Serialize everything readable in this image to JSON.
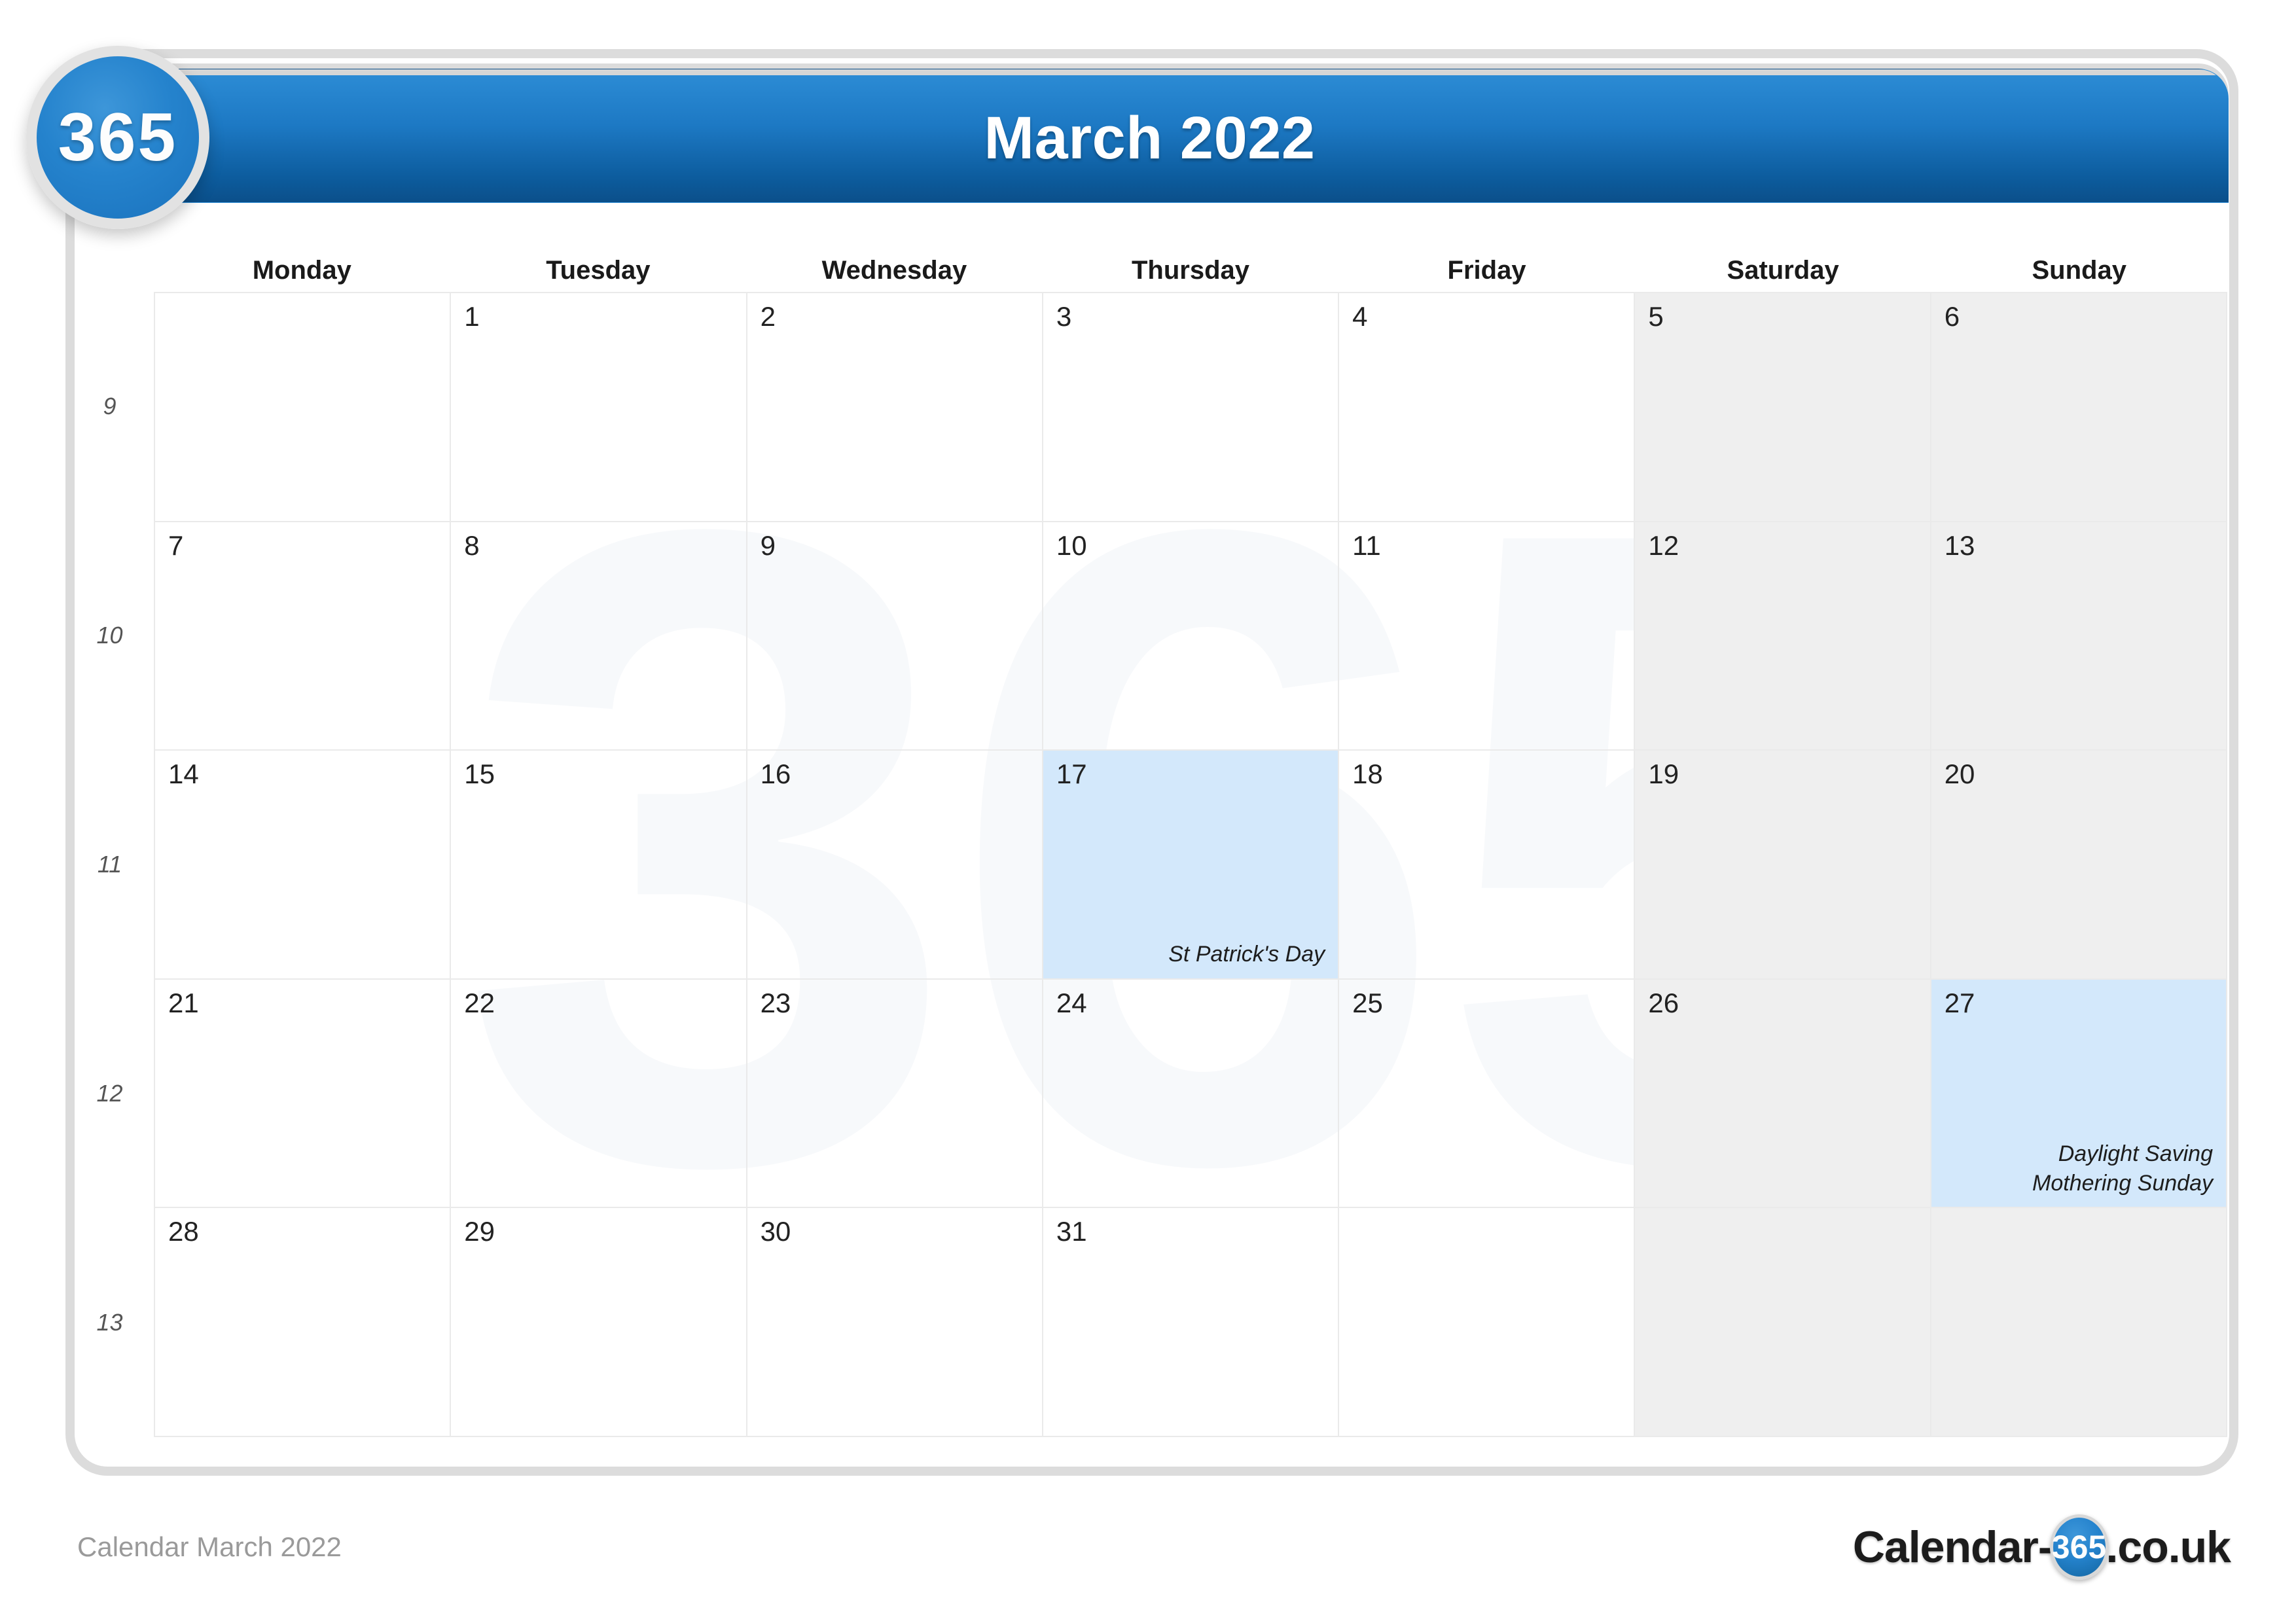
{
  "brand": {
    "badge_label": "365",
    "accent_color": "#1d79c4",
    "weekend_bg": "#efefef",
    "highlight_bg": "#d3e8fb",
    "grid_line_color": "#eaeaea"
  },
  "header": {
    "title": "March 2022"
  },
  "weekdays": [
    "Monday",
    "Tuesday",
    "Wednesday",
    "Thursday",
    "Friday",
    "Saturday",
    "Sunday"
  ],
  "week_numbers": [
    "9",
    "10",
    "11",
    "12",
    "13"
  ],
  "weeks": [
    [
      {
        "day": "",
        "events": [],
        "weekend": false,
        "highlight": false,
        "empty": true
      },
      {
        "day": "1",
        "events": [],
        "weekend": false,
        "highlight": false,
        "empty": false
      },
      {
        "day": "2",
        "events": [],
        "weekend": false,
        "highlight": false,
        "empty": false
      },
      {
        "day": "3",
        "events": [],
        "weekend": false,
        "highlight": false,
        "empty": false
      },
      {
        "day": "4",
        "events": [],
        "weekend": false,
        "highlight": false,
        "empty": false
      },
      {
        "day": "5",
        "events": [],
        "weekend": true,
        "highlight": false,
        "empty": false
      },
      {
        "day": "6",
        "events": [],
        "weekend": true,
        "highlight": false,
        "empty": false
      }
    ],
    [
      {
        "day": "7",
        "events": [],
        "weekend": false,
        "highlight": false,
        "empty": false
      },
      {
        "day": "8",
        "events": [],
        "weekend": false,
        "highlight": false,
        "empty": false
      },
      {
        "day": "9",
        "events": [],
        "weekend": false,
        "highlight": false,
        "empty": false
      },
      {
        "day": "10",
        "events": [],
        "weekend": false,
        "highlight": false,
        "empty": false
      },
      {
        "day": "11",
        "events": [],
        "weekend": false,
        "highlight": false,
        "empty": false
      },
      {
        "day": "12",
        "events": [],
        "weekend": true,
        "highlight": false,
        "empty": false
      },
      {
        "day": "13",
        "events": [],
        "weekend": true,
        "highlight": false,
        "empty": false
      }
    ],
    [
      {
        "day": "14",
        "events": [],
        "weekend": false,
        "highlight": false,
        "empty": false
      },
      {
        "day": "15",
        "events": [],
        "weekend": false,
        "highlight": false,
        "empty": false
      },
      {
        "day": "16",
        "events": [],
        "weekend": false,
        "highlight": false,
        "empty": false
      },
      {
        "day": "17",
        "events": [
          "St Patrick's Day"
        ],
        "weekend": false,
        "highlight": true,
        "empty": false
      },
      {
        "day": "18",
        "events": [],
        "weekend": false,
        "highlight": false,
        "empty": false
      },
      {
        "day": "19",
        "events": [],
        "weekend": true,
        "highlight": false,
        "empty": false
      },
      {
        "day": "20",
        "events": [],
        "weekend": true,
        "highlight": false,
        "empty": false
      }
    ],
    [
      {
        "day": "21",
        "events": [],
        "weekend": false,
        "highlight": false,
        "empty": false
      },
      {
        "day": "22",
        "events": [],
        "weekend": false,
        "highlight": false,
        "empty": false
      },
      {
        "day": "23",
        "events": [],
        "weekend": false,
        "highlight": false,
        "empty": false
      },
      {
        "day": "24",
        "events": [],
        "weekend": false,
        "highlight": false,
        "empty": false
      },
      {
        "day": "25",
        "events": [],
        "weekend": false,
        "highlight": false,
        "empty": false
      },
      {
        "day": "26",
        "events": [],
        "weekend": true,
        "highlight": false,
        "empty": false
      },
      {
        "day": "27",
        "events": [
          "Daylight Saving",
          "Mothering Sunday"
        ],
        "weekend": true,
        "highlight": true,
        "empty": false
      }
    ],
    [
      {
        "day": "28",
        "events": [],
        "weekend": false,
        "highlight": false,
        "empty": false
      },
      {
        "day": "29",
        "events": [],
        "weekend": false,
        "highlight": false,
        "empty": false
      },
      {
        "day": "30",
        "events": [],
        "weekend": false,
        "highlight": false,
        "empty": false
      },
      {
        "day": "31",
        "events": [],
        "weekend": false,
        "highlight": false,
        "empty": false
      },
      {
        "day": "",
        "events": [],
        "weekend": false,
        "highlight": false,
        "empty": true
      },
      {
        "day": "",
        "events": [],
        "weekend": true,
        "highlight": false,
        "empty": true
      },
      {
        "day": "",
        "events": [],
        "weekend": true,
        "highlight": false,
        "empty": true
      }
    ]
  ],
  "watermark": {
    "text": "365"
  },
  "footer": {
    "caption": "Calendar March 2022",
    "logo_prefix": "Calendar-",
    "logo_badge": "365",
    "logo_suffix": ".co.uk"
  }
}
